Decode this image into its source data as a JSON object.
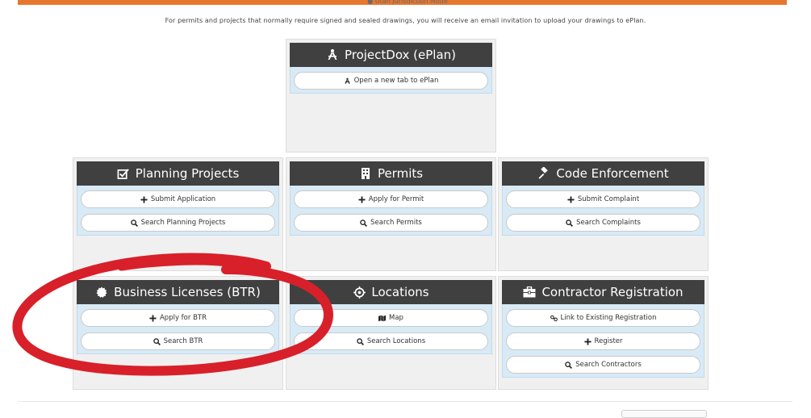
{
  "header": {
    "cut_text": "● Utah Jurisdiction Mode",
    "intro": "For permits and projects that normally require signed and sealed drawings, you will receive an email invitation to upload your drawings to ePlan."
  },
  "cards": {
    "projectdox": {
      "title": "ProjectDox (ePlan)",
      "icon": "compass-icon",
      "actions": [
        {
          "label": "Open a new tab to ePlan",
          "icon": "compass-icon"
        }
      ]
    },
    "planning": {
      "title": "Planning Projects",
      "icon": "checkbox-edit-icon",
      "actions": [
        {
          "label": "Submit Application",
          "icon": "plus-icon"
        },
        {
          "label": "Search Planning Projects",
          "icon": "search-icon"
        }
      ]
    },
    "permits": {
      "title": "Permits",
      "icon": "building-icon",
      "actions": [
        {
          "label": "Apply for Permit",
          "icon": "plus-icon"
        },
        {
          "label": "Search Permits",
          "icon": "search-icon"
        }
      ]
    },
    "code": {
      "title": "Code Enforcement",
      "icon": "gavel-icon",
      "actions": [
        {
          "label": "Submit Complaint",
          "icon": "plus-icon"
        },
        {
          "label": "Search Complaints",
          "icon": "search-icon"
        }
      ]
    },
    "business": {
      "title": "Business Licenses (BTR)",
      "icon": "certificate-icon",
      "actions": [
        {
          "label": "Apply for BTR",
          "icon": "plus-icon"
        },
        {
          "label": "Search BTR",
          "icon": "search-icon"
        }
      ]
    },
    "locations": {
      "title": "Locations",
      "icon": "target-icon",
      "actions": [
        {
          "label": "Map",
          "icon": "map-icon"
        },
        {
          "label": "Search Locations",
          "icon": "search-icon"
        }
      ]
    },
    "contractor": {
      "title": "Contractor Registration",
      "icon": "briefcase-icon",
      "actions": [
        {
          "label": "Link to Existing Registration",
          "icon": "link-icon"
        },
        {
          "label": "Register",
          "icon": "plus-icon"
        },
        {
          "label": "Search Contractors",
          "icon": "search-icon"
        }
      ]
    }
  },
  "colors": {
    "accent_orange": "#e8772e",
    "header_dark": "#404040",
    "panel_blue": "#d8eaf6",
    "annotation_red": "#d8202a"
  }
}
